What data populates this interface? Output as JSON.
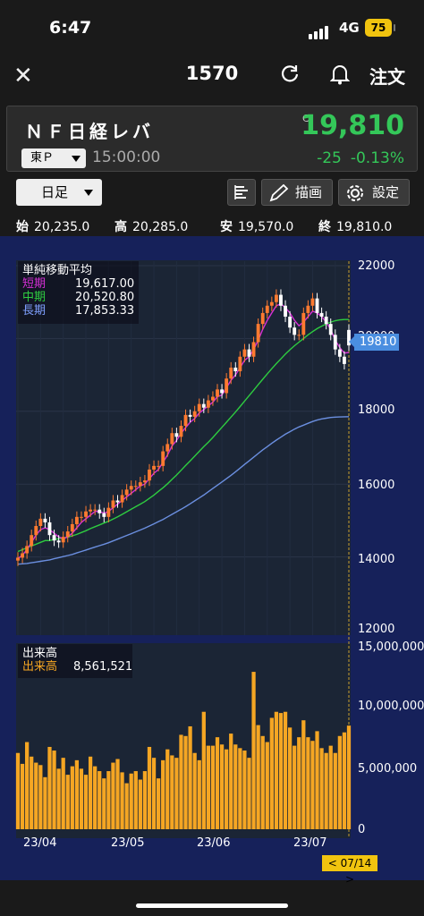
{
  "status_bar": {
    "time": "6:47",
    "network": "4G",
    "battery": "75"
  },
  "nav": {
    "title": "1570",
    "order_label": "注文"
  },
  "quote": {
    "name": "ＮＦ日経レバ",
    "market": "東Ｐ",
    "time": "15:00:00",
    "flag": "C",
    "price": "19,810",
    "change": "-25",
    "change_pct": "-0.13%"
  },
  "toolbar": {
    "period": "日足",
    "draw_label": "描画",
    "settings_label": "設定"
  },
  "ohlc": {
    "open_label": "始",
    "open": "20,235.0",
    "high_label": "高",
    "high": "20,285.0",
    "low_label": "安",
    "low": "19,570.0",
    "close_label": "終",
    "close": "19,810.0"
  },
  "price_legend": {
    "title": "単純移動平均",
    "short_label": "短期",
    "short_value": "19,617.00",
    "mid_label": "中期",
    "mid_value": "20,520.80",
    "long_label": "長期",
    "long_value": "17,853.33"
  },
  "volume_legend": {
    "title": "出来高",
    "label": "出来高",
    "value": "8,561,521"
  },
  "price_axis": [
    "22000",
    "20000",
    "18000",
    "16000",
    "14000",
    "12000"
  ],
  "volume_axis": [
    "15,000,000",
    "10,000,000",
    "5,000,000",
    "0"
  ],
  "x_axis": [
    "23/04",
    "23/05",
    "23/06",
    "23/07"
  ],
  "last_price_tag": "19810",
  "cursor_date": "< 07/14 >",
  "colors": {
    "up": "#ff7a30",
    "down": "#ffffff",
    "short_ma": "#d62fd6",
    "mid_ma": "#2ecc40",
    "long_ma": "#6b8fe0",
    "volume": "#f5a623"
  },
  "chart_data": {
    "type": "candlestick",
    "x_range": [
      "23/03/29",
      "23/07/14"
    ],
    "ylim": [
      12000,
      22000
    ],
    "volume_ylim": [
      0,
      15000000
    ],
    "close": [
      13980,
      14100,
      14300,
      14600,
      14850,
      15050,
      14950,
      14600,
      14450,
      14400,
      14550,
      14700,
      14900,
      15100,
      15100,
      15250,
      15300,
      15300,
      15200,
      15100,
      15350,
      15550,
      15500,
      15700,
      15850,
      15950,
      15950,
      16050,
      16100,
      16400,
      16500,
      16500,
      16900,
      17100,
      17400,
      17300,
      17600,
      17900,
      17850,
      18000,
      18200,
      18100,
      18300,
      18400,
      18600,
      18500,
      18900,
      19200,
      19100,
      19500,
      19700,
      19500,
      19900,
      20400,
      20700,
      20900,
      21000,
      21200,
      20900,
      20600,
      20300,
      20100,
      20100,
      20700,
      20900,
      21100,
      20700,
      20600,
      20400,
      20100,
      19700,
      19500,
      19300,
      19810
    ],
    "open": [
      13900,
      13980,
      14100,
      14300,
      14600,
      14850,
      15050,
      14950,
      14600,
      14450,
      14400,
      14550,
      14700,
      14900,
      15100,
      15100,
      15250,
      15300,
      15300,
      15200,
      15100,
      15350,
      15550,
      15500,
      15700,
      15850,
      15950,
      15950,
      16050,
      16100,
      16400,
      16500,
      16500,
      16900,
      17100,
      17400,
      17300,
      17600,
      17900,
      17850,
      18000,
      18200,
      18100,
      18300,
      18400,
      18600,
      18500,
      18900,
      19200,
      19100,
      19500,
      19700,
      19500,
      19900,
      20400,
      20700,
      20900,
      21000,
      21200,
      20900,
      20600,
      20300,
      20100,
      20100,
      20700,
      20900,
      21100,
      20700,
      20600,
      20400,
      20100,
      19700,
      19500,
      20235
    ],
    "short_ma": [
      13950,
      14050,
      14200,
      14400,
      14600,
      14750,
      14800,
      14750,
      14650,
      14550,
      14500,
      14550,
      14650,
      14800,
      14950,
      15050,
      15150,
      15250,
      15250,
      15200,
      15250,
      15350,
      15450,
      15550,
      15650,
      15750,
      15850,
      15950,
      16000,
      16150,
      16300,
      16400,
      16600,
      16800,
      17050,
      17200,
      17400,
      17550,
      17700,
      17800,
      17950,
      18050,
      18150,
      18250,
      18400,
      18450,
      18650,
      18850,
      19000,
      19200,
      19400,
      19500,
      19700,
      19950,
      20250,
      20500,
      20700,
      20900,
      20950,
      20850,
      20700,
      20500,
      20350,
      20450,
      20600,
      20750,
      20700,
      20600,
      20450,
      20250,
      19950,
      19750,
      19600,
      19617
    ],
    "mid_ma": [
      14150,
      14200,
      14250,
      14300,
      14350,
      14400,
      14450,
      14450,
      14480,
      14500,
      14520,
      14540,
      14580,
      14620,
      14670,
      14720,
      14780,
      14830,
      14880,
      14930,
      14980,
      15040,
      15100,
      15170,
      15240,
      15310,
      15380,
      15450,
      15520,
      15610,
      15700,
      15800,
      15900,
      16010,
      16130,
      16250,
      16380,
      16510,
      16640,
      16770,
      16900,
      17030,
      17150,
      17280,
      17420,
      17560,
      17700,
      17840,
      17980,
      18130,
      18280,
      18430,
      18580,
      18730,
      18880,
      19030,
      19170,
      19310,
      19440,
      19570,
      19690,
      19800,
      19900,
      20000,
      20100,
      20190,
      20270,
      20340,
      20400,
      20450,
      20490,
      20510,
      20520,
      20520.8
    ],
    "long_ma": [
      13800,
      13810,
      13820,
      13840,
      13860,
      13880,
      13900,
      13920,
      13950,
      13980,
      14010,
      14040,
      14070,
      14110,
      14150,
      14190,
      14230,
      14270,
      14310,
      14350,
      14390,
      14440,
      14490,
      14540,
      14590,
      14640,
      14690,
      14740,
      14790,
      14850,
      14910,
      14970,
      15030,
      15100,
      15170,
      15240,
      15310,
      15380,
      15460,
      15540,
      15620,
      15700,
      15790,
      15880,
      15970,
      16060,
      16150,
      16240,
      16340,
      16440,
      16540,
      16640,
      16740,
      16840,
      16940,
      17030,
      17120,
      17210,
      17290,
      17370,
      17440,
      17510,
      17570,
      17620,
      17670,
      17720,
      17760,
      17790,
      17810,
      17830,
      17840,
      17845,
      17850,
      17853.33
    ],
    "volume": [
      6300000,
      5400000,
      7200000,
      6000000,
      5500000,
      5300000,
      4300000,
      6800000,
      6500000,
      5000000,
      5900000,
      4500000,
      5200000,
      5700000,
      5000000,
      4500000,
      6000000,
      5200000,
      4800000,
      4200000,
      4800000,
      5500000,
      5800000,
      4700000,
      3800000,
      4600000,
      4800000,
      4100000,
      4800000,
      6800000,
      5900000,
      4200000,
      5700000,
      6600000,
      6100000,
      5900000,
      7800000,
      7700000,
      8500000,
      6300000,
      5700000,
      9700000,
      6900000,
      6900000,
      7600000,
      7000000,
      6600000,
      7900000,
      7000000,
      6700000,
      6500000,
      5900000,
      13000000,
      8600000,
      7700000,
      7200000,
      9200000,
      9700000,
      9600000,
      9700000,
      8400000,
      6900000,
      7600000,
      9000000,
      7600000,
      7300000,
      8100000,
      6700000,
      6300000,
      6900000,
      6300000,
      7700000,
      8000000,
      8561521
    ]
  }
}
